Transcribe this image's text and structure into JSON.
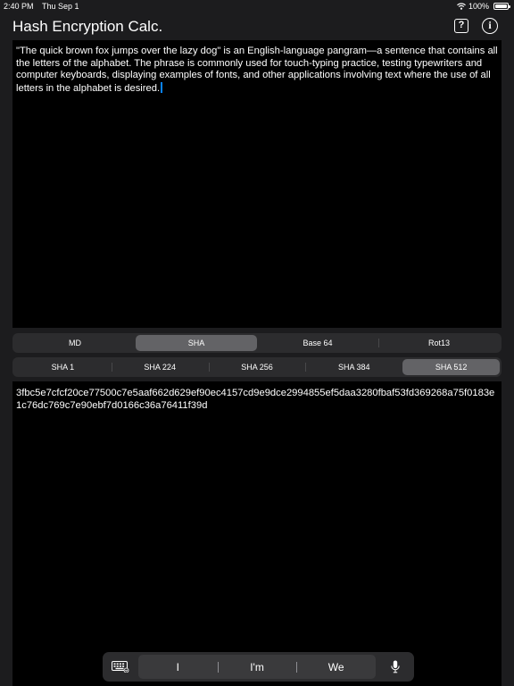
{
  "status": {
    "time": "2:40 PM",
    "date": "Thu Sep 1",
    "battery": "100%",
    "icons": [
      "wifi-icon",
      "battery-icon"
    ]
  },
  "nav": {
    "title": "Hash Encryption Calc.",
    "help_label": "?",
    "info_label": "i"
  },
  "input": {
    "text": "\"The quick brown fox jumps over the lazy dog\" is an English-language pangram—a sentence that contains all the letters of the alphabet. The phrase is commonly used for touch-typing practice, testing typewriters and computer keyboards, displaying examples of fonts, and other applications involving text where the use of all letters in the alphabet is desired."
  },
  "algorithm_tabs": [
    {
      "label": "MD",
      "selected": false
    },
    {
      "label": "SHA",
      "selected": true
    },
    {
      "label": "Base 64",
      "selected": false
    },
    {
      "label": "Rot13",
      "selected": false
    }
  ],
  "variant_tabs": [
    {
      "label": "SHA 1",
      "selected": false
    },
    {
      "label": "SHA 224",
      "selected": false
    },
    {
      "label": "SHA 256",
      "selected": false
    },
    {
      "label": "SHA 384",
      "selected": false
    },
    {
      "label": "SHA 512",
      "selected": true
    }
  ],
  "output": {
    "text": "3fbc5e7cfcf20ce77500c7e5aaf662d629ef90ec4157cd9e9dce2994855ef5daa3280fbaf53fd369268a75f0183e1c76dc769c7e90ebf7d0166c36a76411f39d"
  },
  "predictions": [
    "I",
    "I'm",
    "We"
  ],
  "colors": {
    "background": "#1c1c1e",
    "text_area": "#000000",
    "segment_selected": "#636366",
    "caret": "#0a84ff"
  }
}
